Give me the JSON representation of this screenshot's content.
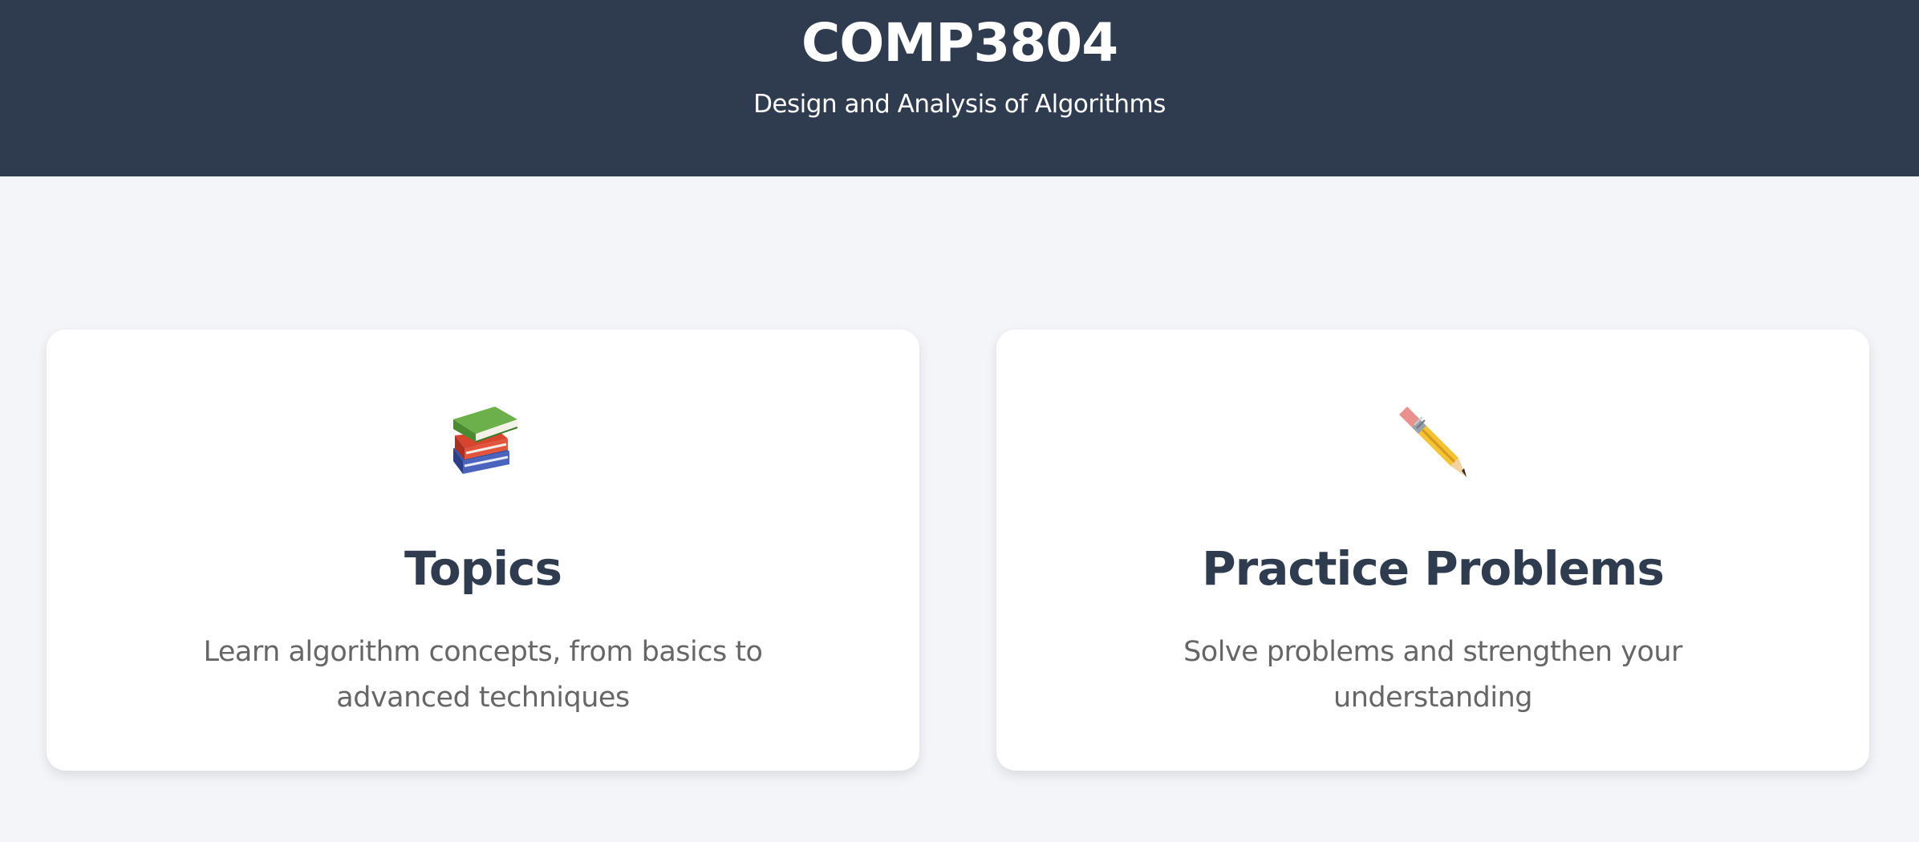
{
  "header": {
    "title": "COMP3804",
    "subtitle": "Design and Analysis of Algorithms"
  },
  "cards": [
    {
      "icon": "books-icon",
      "title": "Topics",
      "description": "Learn algorithm concepts, from basics to advanced techniques"
    },
    {
      "icon": "pencil-icon",
      "title": "Practice Problems",
      "description": "Solve problems and strengthen your understanding"
    }
  ],
  "colors": {
    "header_bg": "#2f3b4e",
    "page_bg": "#f4f5f9",
    "card_bg": "#ffffff",
    "title_text": "#2f3b4e",
    "body_text": "#666666"
  }
}
